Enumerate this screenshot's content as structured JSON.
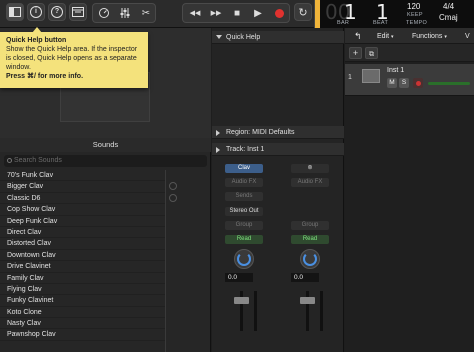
{
  "toolbar": {
    "buttons": [
      {
        "name": "library-button",
        "icon": "library-icon"
      },
      {
        "name": "inspector-button",
        "icon": "info-icon",
        "glyph": "i"
      },
      {
        "name": "quick-help-button",
        "icon": "question-icon",
        "glyph": "?"
      },
      {
        "name": "toolbar-toggle-button",
        "icon": "toolbar-icon"
      },
      {
        "name": "smart-controls-button",
        "icon": "smart-controls-icon"
      },
      {
        "name": "mixer-button",
        "icon": "mixer-icon"
      },
      {
        "name": "editors-button",
        "icon": "scissors-icon"
      }
    ],
    "transport": {
      "rewind": "◀◀",
      "forward": "▶▶",
      "stop": "■",
      "play": "▶",
      "record_color": "#e0322f",
      "cycle": "↻"
    }
  },
  "lcd": {
    "bar_value": "1",
    "beat_value": "1",
    "bar_label": "BAR",
    "beat_label": "BEAT",
    "tempo_value": "120",
    "tempo_keep": "KEEP",
    "tempo_label": "TEMPO",
    "signature": "4/4",
    "key": "Cmaj",
    "accent_color": "#f0b43a"
  },
  "tooltip": {
    "title": "Quick Help button",
    "body": "Show the Quick Help area. If the inspector is closed, Quick Help opens as a separate window.",
    "shortcut": "Press ⌘/ for more info."
  },
  "library": {
    "header": "Sounds",
    "search_placeholder": "Search Sounds",
    "items": [
      "70's Funk Clav",
      "Bigger Clav",
      "Classic D6",
      "Cop Show Clav",
      "Deep Funk Clav",
      "Direct Clav",
      "Distorted Clav",
      "Downtown Clav",
      "Drive Clavinet",
      "Family Clav",
      "Flying Clav",
      "Funky Clavinet",
      "Koto Clone",
      "Nasty Clav",
      "Pawnshop Clav"
    ]
  },
  "inspector": {
    "quick_help_label": "Quick Help",
    "region_label": "Region: MIDI Defaults",
    "track_label": "Track: Inst 1",
    "strip_left": {
      "instrument": "Clav",
      "audio_fx": "Audio FX",
      "sends": "Sends",
      "output": "Stereo Out",
      "group": "Group",
      "automation": "Read",
      "pan_value": "0.0"
    },
    "strip_right": {
      "instrument": "⊚",
      "audio_fx": "Audio FX",
      "group": "Group",
      "automation": "Read",
      "pan_value": "0.0"
    }
  },
  "tracks": {
    "menu": {
      "edit": "Edit",
      "functions": "Functions",
      "view": "V"
    },
    "add_track": "+",
    "track": {
      "number": "1",
      "name": "Inst 1",
      "mute": "M",
      "solo": "S"
    }
  }
}
